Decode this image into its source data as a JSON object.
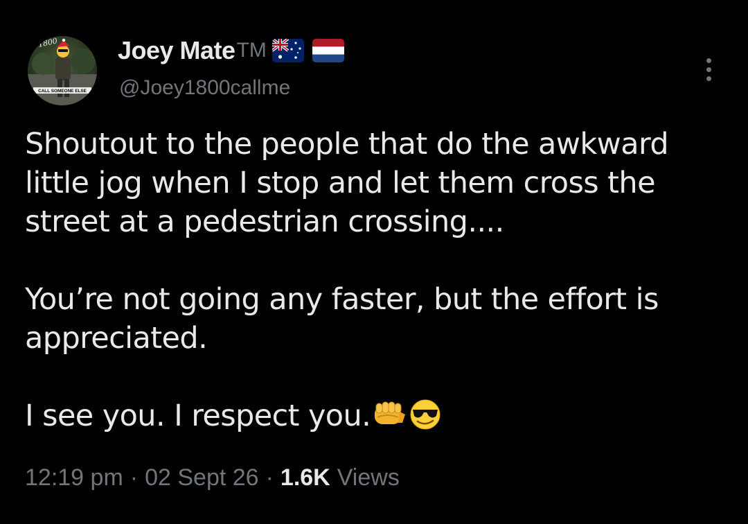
{
  "author": {
    "display_name": "Joey Mate",
    "tm_suffix": "TM",
    "handle": "@Joey1800callme",
    "avatar_text_top": "1800",
    "avatar_text_bottom": "CALL SOMEONE ELSE",
    "flags": [
      "australia-flag",
      "netherlands-flag"
    ]
  },
  "tweet": {
    "paragraphs": [
      "Shoutout to the people that do the awkward little jog when I stop and let them cross the street at a pedestrian crossing....",
      "You’re not going any faster, but the effort is appreciated.",
      "I see you. I respect you."
    ],
    "trailing_emoji": [
      "fist-emoji",
      "sunglasses-emoji"
    ]
  },
  "meta": {
    "time": "12:19 pm",
    "separator": "·",
    "date": "02 Sept 26",
    "views_count": "1.6K",
    "views_label": "Views"
  },
  "colors": {
    "background": "#000000",
    "primary_text": "#e7e9ea",
    "secondary_text": "#71767b"
  },
  "icons": {
    "more": "more-options-icon"
  }
}
